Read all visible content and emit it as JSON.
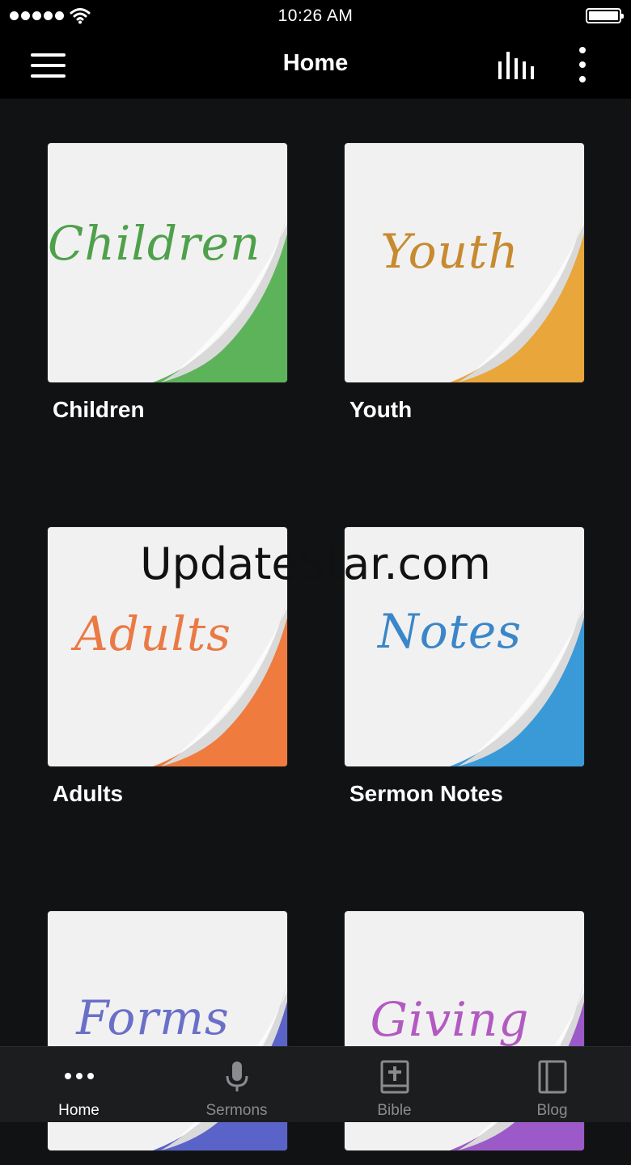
{
  "status_bar": {
    "time": "10:26 AM"
  },
  "nav": {
    "title": "Home",
    "left_icon": "hamburger-menu-icon",
    "right_icons": [
      "audio-bars-icon",
      "more-vertical-icon"
    ]
  },
  "tiles": [
    {
      "script": "Children",
      "caption": "Children",
      "color": "#5db35a",
      "text_color": "#4fa04a"
    },
    {
      "script": "Youth",
      "caption": "Youth",
      "color": "#e8a63b",
      "text_color": "#c78a2e"
    },
    {
      "script": "Adults",
      "caption": "Adults",
      "color": "#ef7b3e",
      "text_color": "#ea7a45"
    },
    {
      "script": "Notes",
      "caption": "Sermon Notes",
      "color": "#3a9ad8",
      "text_color": "#3a86c8"
    },
    {
      "script": "Forms",
      "caption": "",
      "color": "#5a63c8",
      "text_color": "#6a6fc8"
    },
    {
      "script": "Giving",
      "caption": "",
      "color": "#9b5ac8",
      "text_color": "#b25ac2"
    }
  ],
  "watermark": "UpdateStar.com",
  "tab_bar": {
    "tabs": [
      {
        "label": "Home",
        "icon": "more-horizontal-icon",
        "active": true
      },
      {
        "label": "Sermons",
        "icon": "microphone-icon",
        "active": false
      },
      {
        "label": "Bible",
        "icon": "bible-icon",
        "active": false
      },
      {
        "label": "Blog",
        "icon": "book-icon",
        "active": false
      }
    ]
  }
}
